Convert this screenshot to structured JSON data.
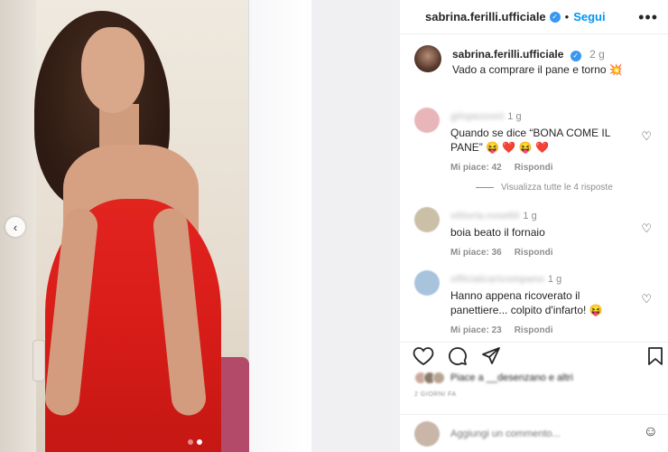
{
  "header": {
    "username": "sabrina.ferilli.ufficiale",
    "verified_icon": "verified-badge-icon",
    "separator": "•",
    "follow_label": "Segui",
    "more_icon": "more-options-icon"
  },
  "caption": {
    "username": "sabrina.ferilli.ufficiale",
    "time": "2 g",
    "text": "Vado a comprare il pane e torno 💥"
  },
  "comments": [
    {
      "username": "gilspezzoni",
      "time": "1 g",
      "text": "Quando se dice “BONA COME IL PANE” 😝 ❤️ 😝 ❤️",
      "likes": "Mi piace: 42",
      "reply_label": "Rispondi",
      "avatar_color": "#e8b5b9"
    },
    {
      "username": "vittoria.rosettii",
      "time": "1 g",
      "text": "boia beato il fornaio",
      "likes": "Mi piace: 36",
      "reply_label": "Rispondi",
      "avatar_color": "#cbbfa8"
    },
    {
      "username": "officialcaricompano",
      "time": "1 g",
      "text": "Hanno appena ricoverato il panettiere... colpito d'infarto! 😝",
      "likes": "Mi piace: 23",
      "reply_label": "Rispondi",
      "avatar_color": "#a8c3dc"
    }
  ],
  "view_replies": "Visualizza tutte le 4 risposte",
  "actions": {
    "like_icon": "heart-icon",
    "comment_icon": "comment-icon",
    "share_icon": "share-icon",
    "save_icon": "bookmark-icon"
  },
  "likes": {
    "text": "Piace a __desenzano e altri"
  },
  "date": "2 GIORNI FA",
  "add_comment": {
    "placeholder": "Aggiungi un commento...",
    "emoji_icon": "emoji-icon"
  },
  "media": {
    "carousel_prev_icon": "chevron-left-icon",
    "slides_total": 2,
    "slide_active": 2
  }
}
